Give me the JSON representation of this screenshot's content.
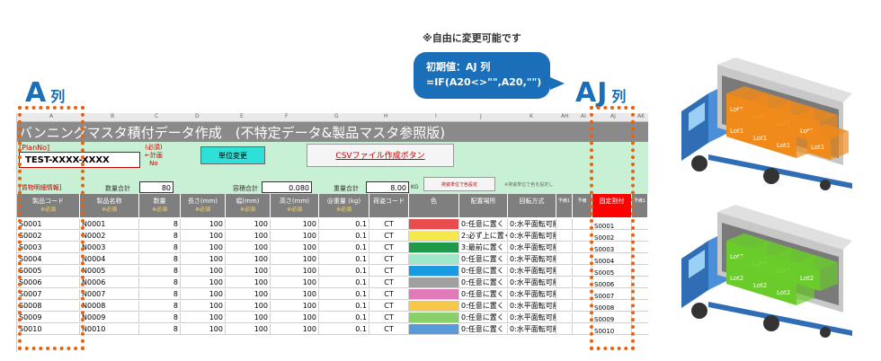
{
  "note": "※自由に変更可能です",
  "bubble": {
    "line1": "初期値：AJ 列",
    "line2": "=IF(A20<>\"\",A20,\"\")"
  },
  "col_a": {
    "letter": "A",
    "suffix": "列"
  },
  "col_aj": {
    "letter": "AJ",
    "suffix": "列"
  },
  "sheet": {
    "col_letters": [
      "A",
      "B",
      "C",
      "D",
      "E",
      "F",
      "G",
      "H",
      "I",
      "J",
      "K",
      "AH",
      "AI",
      "AJ",
      "AK"
    ],
    "title": "バンニングマスタ積付データ作成　(不特定データ&製品マスタ参照版)",
    "plan_label": "[PlanNo]",
    "plan_value": "TEST-XXXX-XXXX",
    "req_note": "(必須)\n←計画\nNo",
    "unit_button": "単位変更",
    "csv_button": "CSVファイル作成ボタン",
    "cargo_label": "[貨物明細情報]",
    "qty_total_label": "数量合計",
    "qty_total": "80",
    "vol_total_label": "容積合計",
    "vol_total": "0.080",
    "weight_total_label": "重量合計",
    "weight_total": "8.00",
    "weight_unit": "KG",
    "recalc_button": "荷姿単位で色設定",
    "hint": "※荷姿単位で色を設定し",
    "headers": [
      {
        "name": "製品コード",
        "req": "※必須"
      },
      {
        "name": "製品名称",
        "req": "※必須"
      },
      {
        "name": "数量",
        "req": "※必須"
      },
      {
        "name": "長さ(mm)",
        "req": "※必須"
      },
      {
        "name": "幅(mm)",
        "req": "※必須"
      },
      {
        "name": "高さ(mm)",
        "req": "※必須"
      },
      {
        "name": "@重量 (kg)",
        "req": "※必須"
      },
      {
        "name": "荷姿コード",
        "req": ""
      },
      {
        "name": "色",
        "req": ""
      },
      {
        "name": "配置場所",
        "req": ""
      },
      {
        "name": "回転方式",
        "req": ""
      },
      {
        "name": "予備1",
        "req": ""
      },
      {
        "name": "予備",
        "req": ""
      },
      {
        "name": "固定割付",
        "req": ""
      },
      {
        "name": "予備1",
        "req": ""
      }
    ],
    "rows": [
      {
        "code": "S0001",
        "name": "N0001",
        "qty": "8",
        "len": "100",
        "wid": "100",
        "hgt": "100",
        "wt": "0.1",
        "pack": "CT",
        "color": "#e84c4c",
        "place": "0:任意に置く",
        "rot": "0:水平面転可能",
        "aj": "S0001"
      },
      {
        "code": "S0002",
        "name": "N0002",
        "qty": "8",
        "len": "100",
        "wid": "100",
        "hgt": "100",
        "wt": "0.1",
        "pack": "CT",
        "color": "#f5e84a",
        "place": "2:必ず上に置く",
        "rot": "0:水平面転可能",
        "aj": "S0002"
      },
      {
        "code": "S0003",
        "name": "N0003",
        "qty": "8",
        "len": "100",
        "wid": "100",
        "hgt": "100",
        "wt": "0.1",
        "pack": "CT",
        "color": "#1e9a4a",
        "place": "3:最前に置く",
        "rot": "0:水平面転可能",
        "aj": "S0003"
      },
      {
        "code": "S0004",
        "name": "N0004",
        "qty": "8",
        "len": "100",
        "wid": "100",
        "hgt": "100",
        "wt": "0.1",
        "pack": "CT",
        "color": "#9fe8c8",
        "place": "0:任意に置く",
        "rot": "0:水平面転可能",
        "aj": "S0004"
      },
      {
        "code": "S0005",
        "name": "N0005",
        "qty": "8",
        "len": "100",
        "wid": "100",
        "hgt": "100",
        "wt": "0.1",
        "pack": "CT",
        "color": "#1a9ae0",
        "place": "0:任意に置く",
        "rot": "0:水平面転可能",
        "aj": "S0005"
      },
      {
        "code": "S0006",
        "name": "N0006",
        "qty": "8",
        "len": "100",
        "wid": "100",
        "hgt": "100",
        "wt": "0.1",
        "pack": "CT",
        "color": "#a0a0a0",
        "place": "0:任意に置く",
        "rot": "0:水平面転可能",
        "aj": "S0006"
      },
      {
        "code": "S0007",
        "name": "N0007",
        "qty": "8",
        "len": "100",
        "wid": "100",
        "hgt": "100",
        "wt": "0.1",
        "pack": "CT",
        "color": "#e07ab8",
        "place": "0:任意に置く",
        "rot": "0:水平面転可能",
        "aj": "S0007"
      },
      {
        "code": "S0008",
        "name": "N0008",
        "qty": "8",
        "len": "100",
        "wid": "100",
        "hgt": "100",
        "wt": "0.1",
        "pack": "CT",
        "color": "#f5c84a",
        "place": "0:任意に置く",
        "rot": "0:水平面転可能",
        "aj": "S0008"
      },
      {
        "code": "S0009",
        "name": "N0009",
        "qty": "8",
        "len": "100",
        "wid": "100",
        "hgt": "100",
        "wt": "0.1",
        "pack": "CT",
        "color": "#8ad06a",
        "place": "0:任意に置く",
        "rot": "0:水平面転可能",
        "aj": "S0009"
      },
      {
        "code": "S0010",
        "name": "N0010",
        "qty": "8",
        "len": "100",
        "wid": "100",
        "hgt": "100",
        "wt": "0.1",
        "pack": "CT",
        "color": "#5a9ad8",
        "place": "0:任意に置く",
        "rot": "0:水平面転可能",
        "aj": "S0010"
      }
    ]
  },
  "truck1": {
    "lot_label": "Lot1",
    "box_color": "#f08a1a",
    "side_color": "#3a7ac8"
  },
  "truck2": {
    "lot_label": "Lot2",
    "box_color": "#6acc2a",
    "side_color": "#3a7ac8"
  }
}
